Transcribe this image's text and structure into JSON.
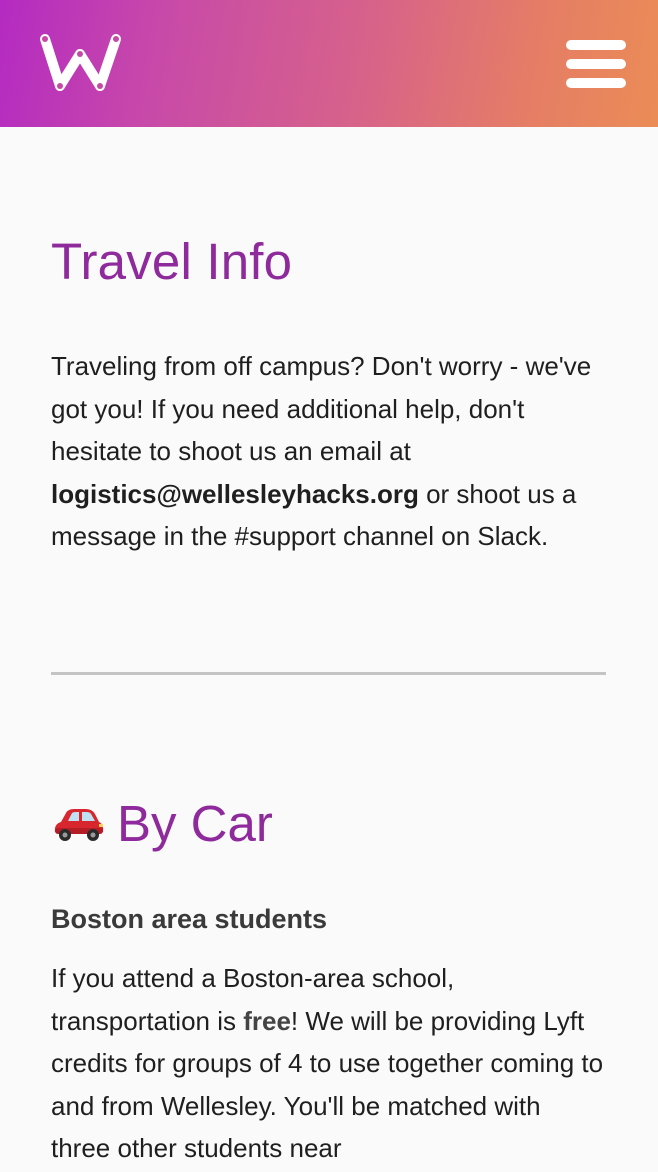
{
  "header": {
    "logo_alt": "W",
    "menu_icon": "hamburger-menu-icon"
  },
  "main": {
    "title": "Travel Info",
    "intro": {
      "part1": "Traveling from off campus? Don't worry - we've got you! If you need additional help, don't hesitate to shoot us an email at ",
      "email": "logistics@wellesleyhacks.org",
      "part2": " or shoot us a message in the #support channel on Slack."
    },
    "by_car": {
      "icon": "car-icon",
      "heading": "By Car",
      "subheading": "Boston area students",
      "text1": "If you attend a Boston-area school, transportation is ",
      "free": "free",
      "text2": "! We will be providing Lyft credits for groups of 4 to use together coming to and from Wellesley. You'll be matched with three other students near"
    }
  },
  "colors": {
    "accent_purple": "#8f2a9c",
    "header_gradient_start": "#b42ac2",
    "header_gradient_end": "#eb8c56"
  }
}
